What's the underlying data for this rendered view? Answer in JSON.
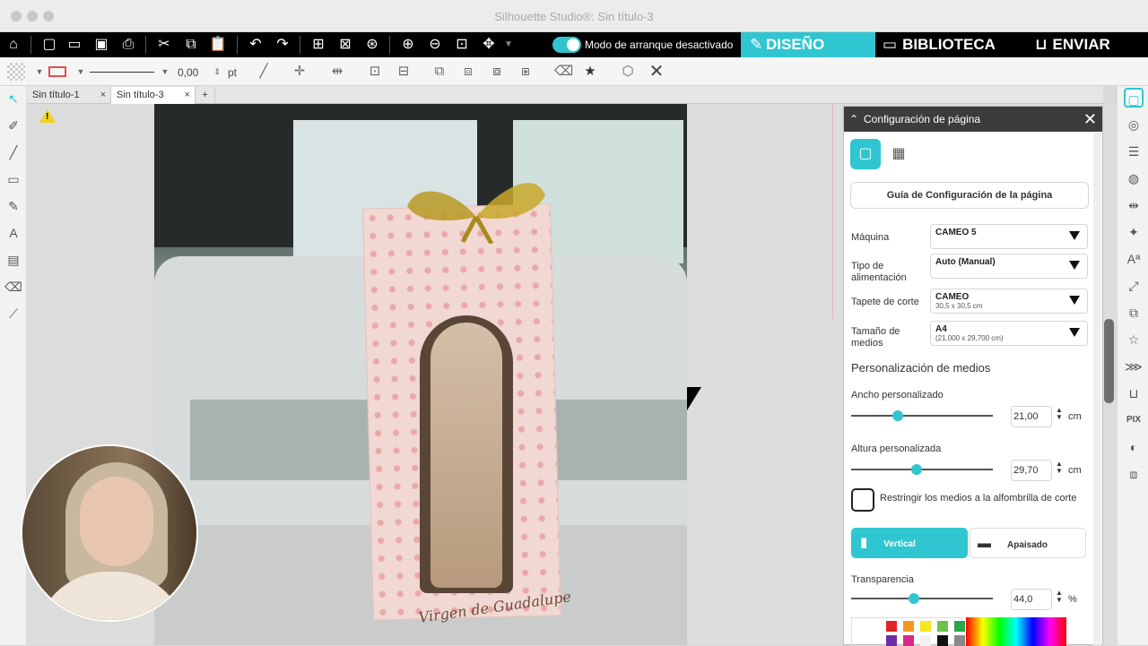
{
  "window": {
    "title": "Silhouette Studio®: Sin título-3"
  },
  "topbar": {
    "startup_toggle_label": "Modo de arranque desactivado",
    "tabs": {
      "design": "DISEÑO",
      "library": "BIBLIOTECA",
      "send": "ENVIAR"
    },
    "icons": [
      "home-icon",
      "new-doc-icon",
      "open-folder-icon",
      "save-icon",
      "print-icon",
      "cut-icon",
      "copy-icon",
      "paste-icon",
      "undo-icon",
      "redo-icon",
      "group-icon",
      "ungroup-icon",
      "compound-icon",
      "zoom-in-icon",
      "zoom-out-icon",
      "zoom-fit-icon",
      "pan-icon"
    ]
  },
  "toolbar": {
    "line_width_value": "0,00",
    "line_width_unit": "pt"
  },
  "doc_tabs": [
    {
      "label": "Sin título-1"
    },
    {
      "label": "Sin título-3"
    }
  ],
  "canvas": {
    "caption_text": "Virgen de Guadalupe"
  },
  "panel": {
    "title": "Configuración de página",
    "guide_button": "Guía de Configuración de la página",
    "machine": {
      "label": "Máquina",
      "value": "CAMEO 5"
    },
    "feed": {
      "label": "Tipo de alimentación",
      "value": "Auto (Manual)"
    },
    "mat": {
      "label": "Tapete de corte",
      "value": "CAMEO",
      "sub": "30,5 x 30,5 cm"
    },
    "media_size": {
      "label": "Tamaño de medios",
      "value": "A4",
      "sub": "(21,000 x 29,700 cm)"
    },
    "media_custom_title": "Personalización de medios",
    "width": {
      "label": "Ancho personalizado",
      "value": "21,00",
      "unit": "cm",
      "fraction": 0.33
    },
    "height": {
      "label": "Altura personalizada",
      "value": "29,70",
      "unit": "cm",
      "fraction": 0.46
    },
    "restrict_label": "Restringir los medios a la alfombrilla de corte",
    "orientation": {
      "portrait": "Vertical",
      "landscape": "Apaisado",
      "selected": "portrait"
    },
    "transparency": {
      "label": "Transparencia",
      "value": "44,0",
      "unit": "%",
      "fraction": 0.44
    },
    "swatches": [
      "#e0242a",
      "#f39a1e",
      "#f6e61a",
      "#6cc24a",
      "#2aa84a",
      "#39a0e0",
      "#6b2fa8",
      "#d62a88",
      "#f2f2f2",
      "#111111",
      "#8a8a8a",
      "#ffffff"
    ]
  },
  "colors": {
    "accent": "#30c6d1",
    "topbar_bg": "#000000"
  }
}
